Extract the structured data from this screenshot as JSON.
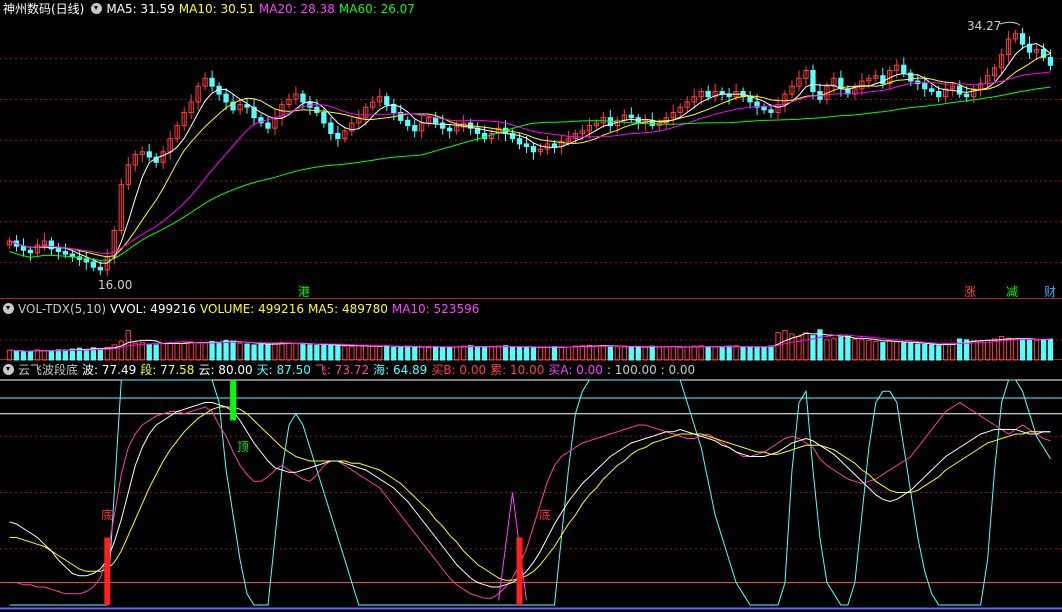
{
  "colors": {
    "up": "#ff3c3c",
    "down": "#54ffff",
    "ma5": "#ffffff",
    "ma10": "#ffff00",
    "ma20": "#ff00ff",
    "ma60": "#00ff00",
    "grid": "#8a1a1a",
    "axis": "#b02020"
  },
  "icons": {
    "panel_menu": "chevron-down-icon"
  },
  "panel1": {
    "title": "神州数码(日线)",
    "ma5_label": "MA5: 31.59",
    "ma10_label": "MA10: 30.51",
    "ma20_label": "MA20: 28.38",
    "ma60_label": "MA60: 26.07",
    "high_annotation": "34.27",
    "low_annotation": "16.00",
    "tag_hk": "港",
    "tag_zhang": "涨",
    "tag_jian": "减",
    "tag_cai": "财"
  },
  "panel2": {
    "title": "VOL-TDX(5,10)",
    "vvol_label": "VVOL: 499216",
    "volume_label": "VOLUME: 499216",
    "ma5_label": "MA5: 489780",
    "ma10_label": "MA10: 523596"
  },
  "panel3": {
    "title": "云飞波段底",
    "bo_label": "波: 77.49",
    "duan_label": "段: 77.58",
    "yun_label": "云: 80.00",
    "tian_label": "天: 87.50",
    "fei_label": "飞: 73.72",
    "hai_label": "海: 64.89",
    "maib_label": "买B: 0.00",
    "lei_label": "累: 10.00",
    "maia_label": "买A: 0.00",
    "tail_label": ": 100.00 : 0.00",
    "signal_top": "顶",
    "signal_bottom_1": "底",
    "signal_bottom_2": "底"
  },
  "chart_data": {
    "type": "candlestick",
    "ylim": [
      15.0,
      35.2
    ],
    "close": [
      18.2,
      17.8,
      17.5,
      17.3,
      17.9,
      18.2,
      17.6,
      17.4,
      17.2,
      17.0,
      16.8,
      16.6,
      16.2,
      16.0,
      17.0,
      19.0,
      22.5,
      24.0,
      24.8,
      25.0,
      24.6,
      24.2,
      25.0,
      26.0,
      27.0,
      28.0,
      28.8,
      30.0,
      30.6,
      30.0,
      29.4,
      28.8,
      28.2,
      28.6,
      28.4,
      27.6,
      27.2,
      26.8,
      27.6,
      28.6,
      29.0,
      29.4,
      28.8,
      28.4,
      28.0,
      27.2,
      26.4,
      26.0,
      26.6,
      27.2,
      27.6,
      28.4,
      28.8,
      29.2,
      28.6,
      28.0,
      27.4,
      27.0,
      26.6,
      27.2,
      27.6,
      27.2,
      26.8,
      26.6,
      26.9,
      27.2,
      26.8,
      26.4,
      26.0,
      26.4,
      26.8,
      26.4,
      26.0,
      25.6,
      25.4,
      25.0,
      25.2,
      25.6,
      25.4,
      25.8,
      26.0,
      26.4,
      26.6,
      27.0,
      27.2,
      27.6,
      27.0,
      27.4,
      27.8,
      27.6,
      27.2,
      27.4,
      27.0,
      27.2,
      27.6,
      28.0,
      28.4,
      28.8,
      29.2,
      29.6,
      29.2,
      29.6,
      29.4,
      29.2,
      29.6,
      29.2,
      28.8,
      28.4,
      28.2,
      28.0,
      28.6,
      29.4,
      30.0,
      30.6,
      31.2,
      29.6,
      29.0,
      30.0,
      30.6,
      29.8,
      29.4,
      29.8,
      30.4,
      30.6,
      30.8,
      30.2,
      31.2,
      31.6,
      31.0,
      30.4,
      30.2,
      29.8,
      29.6,
      29.2,
      29.8,
      30.0,
      29.4,
      29.2,
      29.8,
      30.2,
      30.8,
      31.4,
      32.4,
      33.6,
      34.0,
      33.2,
      32.6,
      32.8,
      32.2,
      31.6
    ]
  },
  "volume_data": {
    "ylim": [
      0,
      1000
    ],
    "values": [
      230,
      220,
      200,
      210,
      240,
      230,
      220,
      240,
      230,
      260,
      280,
      250,
      290,
      270,
      300,
      360,
      450,
      700,
      400,
      420,
      380,
      360,
      390,
      410,
      420,
      400,
      430,
      410,
      420,
      440,
      420,
      470,
      450,
      400,
      380,
      360,
      370,
      380,
      400,
      420,
      410,
      390,
      370,
      360,
      350,
      380,
      360,
      340,
      330,
      320,
      340,
      350,
      330,
      320,
      340,
      300,
      310,
      330,
      320,
      310,
      300,
      320,
      310,
      300,
      320,
      330,
      340,
      320,
      300,
      310,
      330,
      340,
      320,
      300,
      310,
      290,
      300,
      310,
      320,
      300,
      310,
      330,
      340,
      350,
      330,
      340,
      330,
      320,
      310,
      300,
      320,
      310,
      330,
      320,
      310,
      320,
      300,
      310,
      330,
      340,
      320,
      310,
      300,
      330,
      340,
      320,
      300,
      290,
      310,
      330,
      650,
      700,
      620,
      560,
      650,
      580,
      720,
      480,
      520,
      540,
      560,
      500,
      480,
      460,
      440,
      420,
      460,
      430,
      410,
      400,
      380,
      370,
      360,
      340,
      380,
      400,
      500,
      480,
      460,
      450,
      470,
      500,
      560,
      520,
      480,
      500,
      490,
      470,
      490,
      500
    ]
  },
  "osc_data": {
    "ylim": [
      0,
      100
    ],
    "levels": [
      100,
      85,
      10
    ],
    "bo": [
      37,
      36,
      34,
      32,
      30,
      27,
      24,
      20,
      17,
      14,
      13,
      13,
      14,
      16,
      20,
      28,
      38,
      50,
      62,
      70,
      76,
      80,
      82,
      84,
      86,
      87,
      88,
      89,
      90,
      90,
      89,
      88,
      86,
      82,
      77,
      72,
      68,
      64,
      61,
      60,
      59,
      59,
      60,
      61,
      62,
      63,
      64,
      64,
      63,
      62,
      61,
      60,
      58,
      56,
      54,
      52,
      49,
      46,
      42,
      38,
      34,
      30,
      26,
      22,
      18,
      15,
      12,
      10,
      9,
      8,
      8,
      9,
      10,
      12,
      15,
      19,
      24,
      30,
      36,
      41,
      46,
      50,
      54,
      57,
      60,
      63,
      66,
      68,
      70,
      72,
      73,
      74,
      75,
      76,
      77,
      77,
      78,
      77,
      76,
      75,
      74,
      73,
      71,
      70,
      68,
      67,
      66,
      66,
      66,
      67,
      68,
      70,
      72,
      73,
      74,
      73,
      71,
      69,
      67,
      64,
      61,
      58,
      55,
      52,
      49,
      47,
      46,
      47,
      49,
      51,
      54,
      57,
      60,
      63,
      66,
      68,
      70,
      72,
      74,
      76,
      77,
      78,
      78,
      78,
      78,
      77,
      76,
      76,
      77,
      77
    ],
    "duan": [
      30,
      30,
      29,
      28,
      27,
      26,
      24,
      22,
      20,
      18,
      16,
      15,
      15,
      15,
      16,
      19,
      24,
      31,
      38,
      45,
      52,
      58,
      64,
      69,
      73,
      77,
      80,
      83,
      85,
      87,
      88,
      88,
      88,
      87,
      85,
      82,
      79,
      76,
      73,
      70,
      68,
      66,
      65,
      64,
      64,
      64,
      64,
      64,
      64,
      63,
      63,
      62,
      61,
      60,
      58,
      56,
      54,
      51,
      48,
      45,
      42,
      38,
      35,
      31,
      28,
      24,
      21,
      18,
      16,
      14,
      12,
      11,
      11,
      12,
      13,
      15,
      18,
      22,
      26,
      31,
      36,
      40,
      45,
      49,
      52,
      56,
      59,
      62,
      64,
      67,
      69,
      70,
      72,
      73,
      74,
      75,
      76,
      76,
      76,
      76,
      75,
      74,
      73,
      72,
      71,
      70,
      69,
      68,
      68,
      67,
      67,
      68,
      69,
      70,
      71,
      71,
      71,
      70,
      69,
      67,
      65,
      63,
      60,
      58,
      55,
      53,
      51,
      50,
      50,
      50,
      51,
      53,
      55,
      57,
      60,
      62,
      64,
      66,
      68,
      70,
      72,
      73,
      74,
      75,
      76,
      76,
      77,
      77,
      77,
      77
    ],
    "fei": [
      10,
      10,
      9,
      9,
      8,
      8,
      7,
      6,
      5,
      5,
      5,
      6,
      8,
      12,
      22,
      40,
      58,
      70,
      76,
      80,
      82,
      84,
      85,
      86,
      86,
      85,
      86,
      87,
      88,
      86,
      80,
      75,
      68,
      62,
      58,
      55,
      55,
      57,
      60,
      62,
      60,
      58,
      56,
      55,
      58,
      62,
      64,
      64,
      62,
      60,
      58,
      56,
      54,
      52,
      48,
      44,
      40,
      36,
      32,
      28,
      24,
      20,
      16,
      12,
      9,
      7,
      5,
      4,
      3,
      3,
      5,
      8,
      12,
      18,
      25,
      35,
      45,
      55,
      62,
      66,
      68,
      70,
      72,
      73,
      74,
      75,
      76,
      77,
      78,
      79,
      80,
      80,
      79,
      78,
      77,
      76,
      75,
      74,
      74,
      75,
      76,
      74,
      72,
      70,
      68,
      66,
      66,
      67,
      68,
      70,
      72,
      74,
      75,
      74,
      72,
      70,
      65,
      62,
      60,
      58,
      56,
      55,
      54,
      55,
      56,
      58,
      60,
      62,
      64,
      66,
      70,
      74,
      78,
      82,
      86,
      88,
      90,
      88,
      86,
      84,
      82,
      80,
      78,
      76,
      78,
      80,
      78,
      76,
      74,
      73
    ],
    "hai": [
      0,
      0,
      0,
      0,
      0,
      0,
      0,
      0,
      0,
      0,
      0,
      0,
      0,
      0,
      0,
      50,
      100,
      100,
      100,
      100,
      100,
      100,
      100,
      100,
      100,
      100,
      100,
      100,
      100,
      100,
      90,
      60,
      40,
      20,
      5,
      0,
      0,
      0,
      30,
      60,
      80,
      85,
      80,
      70,
      60,
      50,
      40,
      30,
      20,
      10,
      0,
      0,
      0,
      0,
      0,
      0,
      0,
      0,
      0,
      0,
      0,
      0,
      0,
      0,
      0,
      0,
      0,
      0,
      0,
      0,
      0,
      0,
      0,
      0,
      0,
      0,
      0,
      0,
      0,
      30,
      60,
      85,
      95,
      100,
      100,
      100,
      100,
      100,
      100,
      100,
      100,
      100,
      100,
      100,
      100,
      100,
      100,
      90,
      80,
      70,
      55,
      40,
      30,
      20,
      10,
      5,
      0,
      0,
      0,
      0,
      0,
      10,
      60,
      90,
      95,
      60,
      30,
      10,
      5,
      0,
      0,
      10,
      40,
      70,
      90,
      95,
      95,
      90,
      70,
      50,
      30,
      15,
      5,
      0,
      0,
      0,
      0,
      0,
      0,
      0,
      20,
      60,
      90,
      100,
      100,
      95,
      85,
      75,
      70,
      65
    ],
    "signals": [
      {
        "type": "bottom",
        "index": 14
      },
      {
        "type": "top",
        "index": 32
      },
      {
        "type": "bottom",
        "index": 73
      }
    ]
  }
}
